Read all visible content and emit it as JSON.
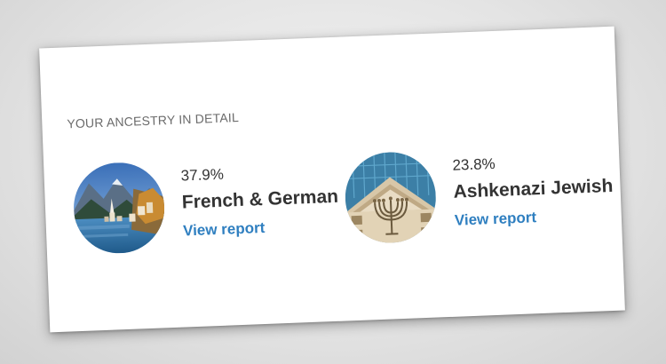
{
  "section": {
    "title": "YOUR ANCESTRY IN DETAIL"
  },
  "regions": [
    {
      "percent": "37.9%",
      "name": "French & German",
      "link_label": "View report",
      "image_icon": "alpine-lake-village-photo"
    },
    {
      "percent": "23.8%",
      "name": "Ashkenazi Jewish",
      "link_label": "View report",
      "image_icon": "menorah-building-facade-photo"
    }
  ],
  "colors": {
    "link": "#2f7fc0",
    "text": "#333333",
    "heading": "#6b6b6b"
  }
}
